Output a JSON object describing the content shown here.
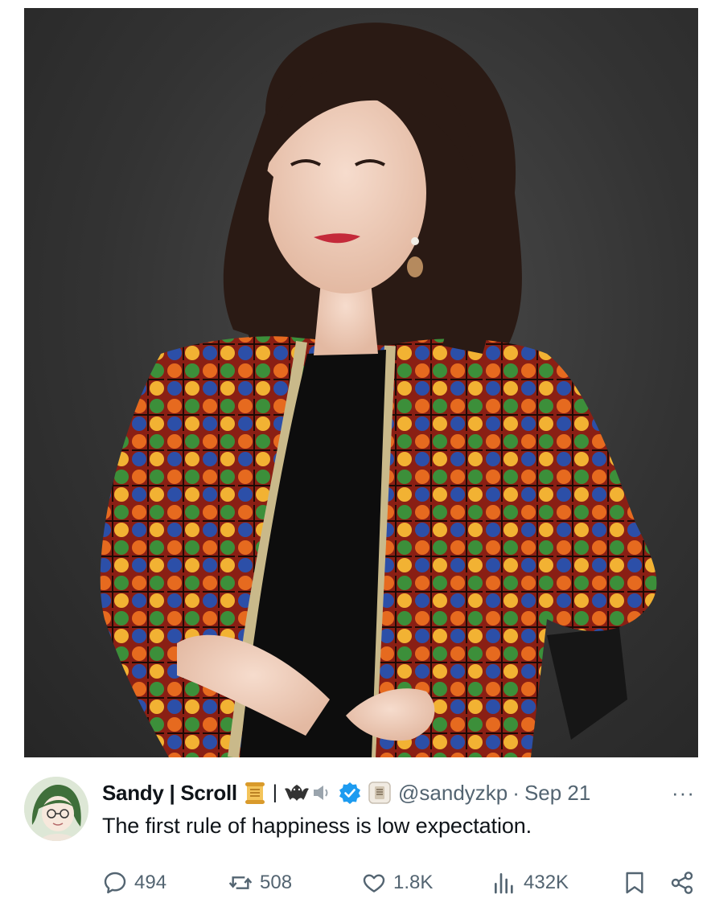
{
  "post": {
    "display_name": "Sandy | Scroll",
    "separator": "|",
    "handle": "@sandyzkp",
    "dot": "·",
    "date": "Sep 21",
    "more": "···",
    "text": "The first rule of happiness is low expectation."
  },
  "stats": {
    "replies": "494",
    "reposts": "508",
    "likes": "1.8K",
    "views": "432K"
  },
  "icons": [
    "scroll-emoji-icon",
    "bat-icon",
    "speaker-icon",
    "verified-badge-icon",
    "affiliate-badge-icon",
    "reply-icon",
    "repost-icon",
    "like-icon",
    "views-icon",
    "bookmark-icon",
    "share-icon"
  ],
  "colors": {
    "text_primary": "#0f1419",
    "text_secondary": "#536471",
    "verified_blue": "#1d9bf0",
    "photo_background": "#333333"
  }
}
